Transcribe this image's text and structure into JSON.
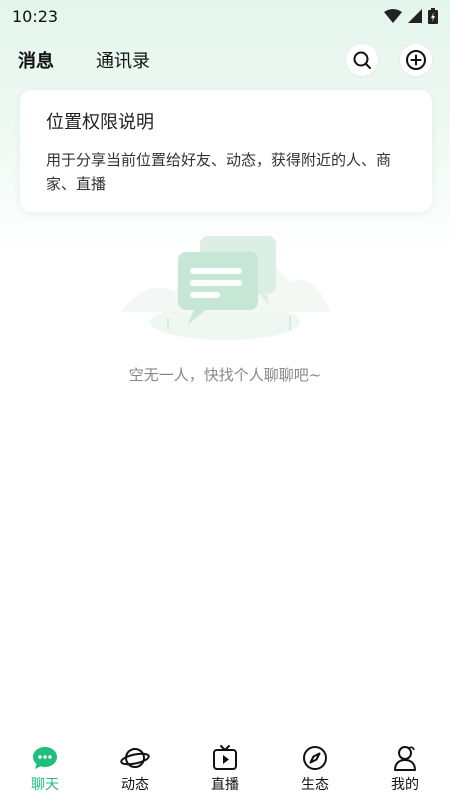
{
  "status_bar": {
    "time": "10:23"
  },
  "header": {
    "tabs": [
      {
        "label": "消息",
        "active": true
      },
      {
        "label": "通讯录",
        "active": false
      }
    ],
    "actions": {
      "search_icon": "search-icon",
      "add_icon": "plus-circle-icon"
    }
  },
  "permission_card": {
    "title": "位置权限说明",
    "description": "用于分享当前位置给好友、动态，获得附近的人、商家、直播"
  },
  "empty_state": {
    "text": "空无一人，快找个人聊聊吧~",
    "icon": "chat-bubbles-illustration"
  },
  "bottom_nav": {
    "items": [
      {
        "label": "聊天",
        "icon": "chat-icon",
        "active": true
      },
      {
        "label": "动态",
        "icon": "planet-icon",
        "active": false
      },
      {
        "label": "直播",
        "icon": "tv-play-icon",
        "active": false
      },
      {
        "label": "生态",
        "icon": "compass-icon",
        "active": false
      },
      {
        "label": "我的",
        "icon": "user-icon",
        "active": false
      }
    ]
  },
  "colors": {
    "accent": "#1fbe7a",
    "text_primary": "#222222",
    "text_muted": "#888888"
  }
}
